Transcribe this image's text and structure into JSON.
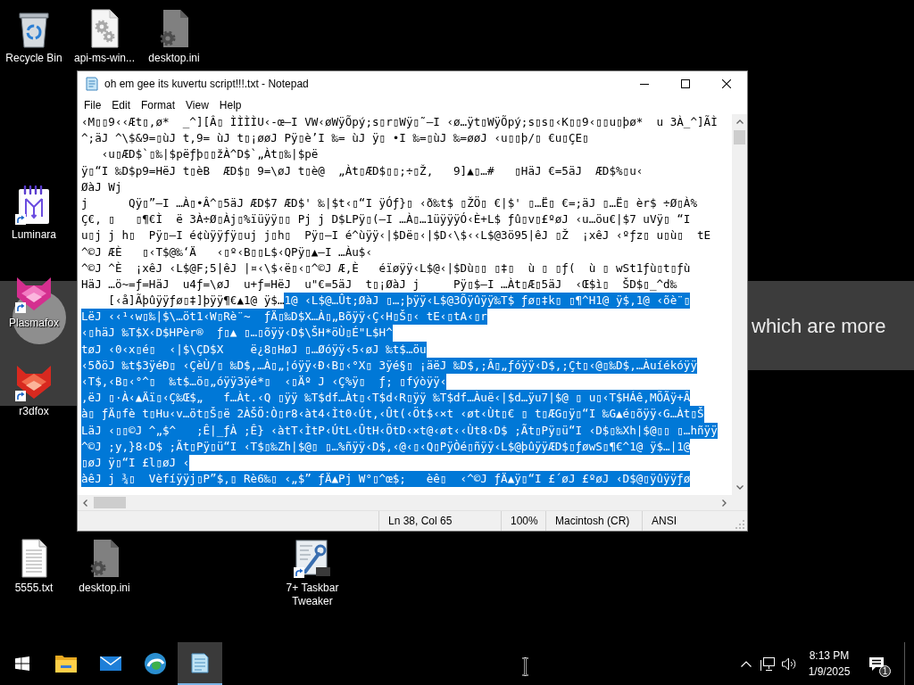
{
  "desktop": {
    "caption": "which are more",
    "icons": [
      {
        "label": "Recycle Bin",
        "kind": "bin",
        "shortcut": false
      },
      {
        "label": "api-ms-win...",
        "kind": "gearsfile",
        "shortcut": false
      },
      {
        "label": "desktop.ini",
        "kind": "inifile",
        "shortcut": false
      },
      {
        "label": "Luminara",
        "kind": "notebook",
        "shortcut": true
      },
      {
        "label": "Plasmafox",
        "kind": "foxpink",
        "shortcut": true
      },
      {
        "label": "r3dfox",
        "kind": "foxred",
        "shortcut": true
      },
      {
        "label": "5555.txt",
        "kind": "textfile",
        "shortcut": false
      },
      {
        "label": "desktop.ini",
        "kind": "inifile",
        "shortcut": false
      },
      {
        "label": "7+ Taskbar Tweaker",
        "kind": "wrench",
        "shortcut": true
      }
    ]
  },
  "notepad": {
    "title": "oh em gee its kuvertu script!!!.txt - Notepad",
    "menu": [
      "File",
      "Edit",
      "Format",
      "View",
      "Help"
    ],
    "lines": [
      {
        "segments": [
          {
            "text": "‹M▯▯9‹‹Æt▯‚ø*  _^][Â▯ ÌÌÌÌU‹-œ–I VW‹øWÿÕpý;s▯r▯Wÿ▯˜–I ‹ø…ÿt▯WÿÕpý;s▯s▯‹K▯▯9‹▯▯u▯þø*  u 3À_^]ÃÌ",
            "selected": false
          }
        ]
      },
      {
        "segments": [
          {
            "text": "^;äJ ^\\$&9=▯ùJ t,9= ùJ t▯¡øøJ Pÿ▯è’I ‰= ùJ ÿ▯ •I ‰=▯ùJ ‰=øøJ ‹u▯▯þ/▯ €u▯ÇE▯",
            "selected": false
          }
        ]
      },
      {
        "segments": [
          {
            "text": "   ‹u▯ÆD$`▯‰|$pëƒþ▯▯žÀ^D$`„Àt▯‰|$pë",
            "selected": false
          }
        ]
      },
      {
        "segments": [
          {
            "text": "ÿ▯“I ‰D$p9=HëJ t▯èB  ÆD$▯ 9=\\øJ t▯è@  „Àt▯ÆD$▯▯;÷▯Ž,   9]▲▯…#   ▯HäJ €=5äJ  ÆD$%▯u‹",
            "selected": false
          }
        ]
      },
      {
        "segments": [
          {
            "text": "ØàJ Wj",
            "selected": false
          }
        ]
      },
      {
        "segments": [
          {
            "text": "j      Qÿ▯”–I …À▯•Â^▯5äJ ÆD$7 ÆD$' ‰|$t‹▯“I ÿÓƒ}▯ ‹ð‰t$ ▯ŽÖ▯ €|$' ▯…Ë▯ €=;äJ ▯…Ë▯ èr$ ÷Ø▯À%",
            "selected": false
          }
        ]
      },
      {
        "segments": [
          {
            "text": "Ç€‚ ▯   ▯¶€Ì  ë 3À÷Ø▯Àj▯%ïüÿÿ▯▯ Pj j D$LPÿ▯(–I …À▯…1üÿÿÿÓ‹È+L$ ƒû▯v▯£ºøJ ‹u…öu€|$7 uVÿ▯ “I",
            "selected": false
          }
        ]
      },
      {
        "segments": [
          {
            "text": "u▯j j h▯  Pÿ▯–I é¢ùÿÿƒÿ▯uj j▯h▯  Pÿ▯–I é^ùÿÿ‹|$Dë▯‹|$D‹\\$‹‹L$@3ö95|êJ ▯Ž  ¡xêJ ‹ºƒz▯ u▯ù▯  tE",
            "selected": false
          }
        ]
      },
      {
        "segments": [
          {
            "text": "^©J ÆÈ   ▯‹T$@‰‘Ä   ‹▯º‹B▯▯L$‹QPÿ▯▲–I …Àu$‹",
            "selected": false
          }
        ]
      },
      {
        "segments": [
          {
            "text": "^©J ^È  ¡xêJ ‹L$@F;5|êJ |¤‹\\$‹ë▯‹▯^©J Æ,È   éïøÿÿ‹L$@‹|$Dù▯▯ ▯‡▯  ù ▯ ▯ƒ(  ù ▯ wSt1ƒù▯t▯ƒù",
            "selected": false
          }
        ]
      },
      {
        "segments": [
          {
            "text": "HäJ …ö~=ƒ=HäJ  u4ƒ=\\øJ  u+ƒ=HëJ  u\"€=5äJ  t▯¡ØàJ j     Pÿ▯$–I …Àt▯Æ▯5äJ  ‹Œ$ì▯  ŠD$▯_^d‰",
            "selected": false
          }
        ]
      },
      {
        "segments": [
          {
            "text": "    [‹å]Ãþûÿÿƒø▯‡]þÿÿ¶€▲1@ ÿ$…",
            "selected": false
          },
          {
            "text": "1@ ‹L$@…Ût;ØàJ ▯…;þÿÿ‹L$@3Õÿûÿÿ‰T$ ƒø▯‡k▯ ▯¶^H1@ ÿ$,1@ ‹õè¨▯",
            "selected": true
          }
        ]
      },
      {
        "segments": [
          {
            "text": "LëJ ‹‹¹‹w▯‰|$\\…öt1‹W▯Rè¨~  ƒÄ▯‰D$X…À▯„Bõÿÿ‹Ç‹H▯Š▯‹ tE‹▯tA‹▯r",
            "selected": true
          }
        ]
      },
      {
        "segments": [
          {
            "text": "‹▯häJ ‰T$X‹D$HPèr®  ƒ▯▲ ▯…▯õÿÿ‹D$\\ŠH*öÙ▯É\"L$H^",
            "selected": true
          }
        ]
      },
      {
        "segments": [
          {
            "text": "tøJ ‹0‹x▯é▯  ‹|$\\ÇD$X    ë¿8▯HøJ ▯…Øóÿÿ‹5‹øJ ‰t$…öu",
            "selected": true
          }
        ]
      },
      {
        "segments": [
          {
            "text": "‹5ðöJ ‰t$3ÿéÐ▯ ‹ÇèÙ/▯ ‰D$,…À▯„¦óÿÿ‹Ð‹B▯‹°X▯ 3ÿé§▯ ¡äëJ ‰D$,;Â▯„ƒóÿÿ‹D$,;Çt▯‹@▯‰D$,…Àuíékóÿÿ",
            "selected": true
          }
        ]
      },
      {
        "segments": [
          {
            "text": "‹T$,‹B▯‹°^▯  ‰t$…ö▯„óÿÿ3ÿé*▯  ‹▯Äº J ‹Ç%ÿ▯  ƒ; ▯fýòÿÿ‹",
            "selected": true
          }
        ]
      },
      {
        "segments": [
          {
            "text": ",ëJ ▯·À‹▲Äï▯‹Ç‰Œ$„   f…Àt.‹Q ▯ÿÿ ‰T$df…Àt▯‹T$d‹R▯ÿÿ ‰T$df…Àuë‹|$d…ÿu7|$@ ▯ u▯‹T$HÁê‚MÕÃÿ+Â",
            "selected": true
          }
        ]
      },
      {
        "segments": [
          {
            "text": "à▯ ƒÄ▯fè t▯Hu‹v…öt▯Š▯ë 2ÀŠÖ:Ò▯r8‹àt4‹Ìt0‹Út,‹Ût(‹Öt$‹×t ‹øt‹Ùt▯€ ▯ t▯ÆG▯ÿ▯“I ‰G▲é▯õÿÿ‹G…Àt▯Š",
            "selected": true
          }
        ]
      },
      {
        "segments": [
          {
            "text": "LäJ ‹▯▯©J ^„$^   ;Ê|_ƒÀ ;Ê} ‹àtT‹ÌtP‹ÚtL‹ÛtH‹ÖtD‹×t@‹øt‹‹Ùt8‹D$ ;Ãt▯Pÿ▯ü“I ‹D$▯‰Xh|$@▯▯ ▯…hñÿÿ",
            "selected": true
          }
        ]
      },
      {
        "segments": [
          {
            "text": "^©J ;y,}8‹D$ ;Ãt▯Pÿ▯ü“I ‹T$▯‰Zh|$@▯ ▯…%ñÿÿ‹D$,‹@‹▯‹Q▯PÿÒé▯ñÿÿ‹L$@þûÿÿÆD$▯ƒøwS▯¶€^1@ ÿ$…|1@",
            "selected": true
          }
        ]
      },
      {
        "segments": [
          {
            "text": "▯øJ ÿ▯“I £l▯øJ ‹",
            "selected": true
          }
        ]
      },
      {
        "segments": [
          {
            "text": "àêJ j ¾▯  Vèfíÿÿj▯P”$‚▯ Rè6‰▯ ‹„$” ƒÄ▲Pj W°▯^œ$;   èê▯  ‹^©J ƒÄ▲ÿ▯“I £´øJ £ºøJ ‹D$@▯ÿûÿÿƒø",
            "selected": true
          }
        ]
      }
    ],
    "status": {
      "position": "Ln 38, Col 65",
      "zoom": "100%",
      "line_ending": "Macintosh (CR)",
      "encoding": "ANSI"
    }
  },
  "taskbar": {
    "apps": [
      {
        "kind": "explorer",
        "active": false
      },
      {
        "kind": "mail",
        "active": false
      },
      {
        "kind": "browser",
        "active": false
      },
      {
        "kind": "notepad",
        "active": true
      }
    ],
    "time": "8:13 PM",
    "date": "1/9/2025",
    "notification_count": "1"
  }
}
